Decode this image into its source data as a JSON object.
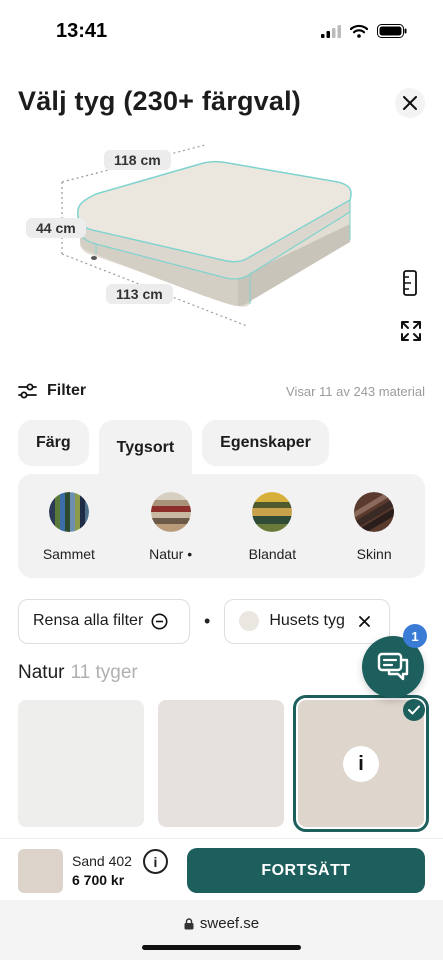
{
  "status": {
    "time": "13:41"
  },
  "header": {
    "title": "Välj tyg (230+ färgval)"
  },
  "dimensions": {
    "width": "118 cm",
    "height": "44 cm",
    "depth": "113 cm"
  },
  "filter": {
    "label": "Filter",
    "count_text": "Visar 11 av 243 material"
  },
  "tabs": [
    {
      "label": "Färg",
      "active": false
    },
    {
      "label": "Tygsort",
      "active": true
    },
    {
      "label": "Egenskaper",
      "active": false
    }
  ],
  "fabric_types": [
    {
      "label": "Sammet",
      "icon": "velvet-swatch"
    },
    {
      "label": "Natur •",
      "icon": "natural-swatch"
    },
    {
      "label": "Blandat",
      "icon": "mixed-swatch"
    },
    {
      "label": "Skinn",
      "icon": "leather-swatch"
    }
  ],
  "chips": {
    "clear_label": "Rensa alla filter",
    "separator": "•",
    "active_filter": "Husets tyg"
  },
  "section": {
    "title": "Natur",
    "count": "11 tyger"
  },
  "fabrics": [
    {
      "color": "#eeeeec",
      "selected": false
    },
    {
      "color": "#e6e1df",
      "selected": false
    },
    {
      "color": "#ded5cc",
      "selected": true
    }
  ],
  "chat": {
    "badge_count": "1"
  },
  "selection": {
    "name": "Sand 402",
    "price": "6 700 kr",
    "info_symbol": "i"
  },
  "actions": {
    "continue_label": "FORTSÄTT"
  },
  "browser": {
    "url": "sweef.se"
  },
  "colors": {
    "accent": "#1d5f5d",
    "badge": "#3a7bd5"
  }
}
